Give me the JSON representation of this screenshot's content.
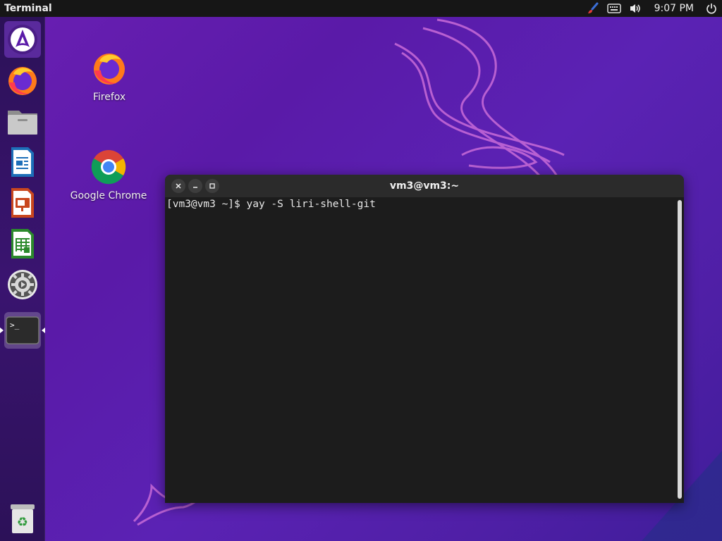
{
  "topbar": {
    "app_title": "Terminal",
    "clock": "9:07 PM",
    "indicators": [
      "paintbrush-icon",
      "keyboard-icon",
      "volume-icon",
      "power-icon"
    ]
  },
  "dock": {
    "items": [
      {
        "name": "arch-launcher",
        "icon": "arch-logo-icon"
      },
      {
        "name": "firefox",
        "icon": "firefox-icon"
      },
      {
        "name": "files",
        "icon": "folder-icon"
      },
      {
        "name": "writer",
        "icon": "libreoffice-writer-icon"
      },
      {
        "name": "impress",
        "icon": "libreoffice-impress-icon"
      },
      {
        "name": "calc",
        "icon": "libreoffice-calc-icon"
      },
      {
        "name": "settings",
        "icon": "gear-icon"
      },
      {
        "name": "terminal",
        "icon": "terminal-icon",
        "active": true
      },
      {
        "name": "trash",
        "icon": "trash-icon"
      }
    ]
  },
  "desktop": {
    "icons": [
      {
        "label": "Firefox",
        "icon": "firefox-icon"
      },
      {
        "label": "Google Chrome",
        "icon": "chrome-icon"
      }
    ]
  },
  "terminal": {
    "title": "vm3@vm3:~",
    "lines": [
      "[vm3@vm3 ~]$ yay -S liri-shell-git"
    ]
  },
  "colors": {
    "wallpaper": "#5a1aa8",
    "topbar": "#161616",
    "terminal_bg": "#1c1c1c",
    "wallpaper_line": "#c86ad6"
  }
}
